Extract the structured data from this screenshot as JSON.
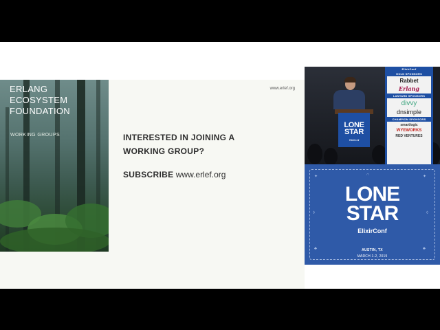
{
  "slide": {
    "foundation_lines": [
      "ERLANG",
      "ECOSYSTEM",
      "FOUNDATION"
    ],
    "section": "WORKING GROUPS",
    "url": "www.erlef.org",
    "question_lines": [
      "INTERESTED IN JOINING A",
      "WORKING GROUP?"
    ],
    "subscribe_label": "SUBSCRIBE",
    "subscribe_url": "www.erlef.org"
  },
  "camera": {
    "board_heading": "ElixirConf",
    "gold_sponsors_label": "GOLD SPONSORS",
    "gold_sponsors": [
      "Rabbet",
      "Erlang"
    ],
    "lanyard_sponsors_label": "LANYARD SPONSORS",
    "lanyard_sponsors": [
      "divvy",
      "dnsimple"
    ],
    "champion_sponsors_label": "CHAMPION SPONSORS",
    "champion_sponsors": [
      "smartlogic",
      "WYEWORKS",
      "RED VENTURES"
    ],
    "podium_logo": [
      "LONE",
      "STAR"
    ],
    "podium_sub": "ElixirConf"
  },
  "conference": {
    "title_lines": [
      "LONE",
      "STAR"
    ],
    "subtitle": "ElixirConf",
    "location": "AUSTIN, TX",
    "dates": "MARCH 1-2, 2019"
  },
  "colors": {
    "conference_blue": "#2f5aa8",
    "slide_background": "#f7f8f3",
    "letterbox": "#000000"
  }
}
